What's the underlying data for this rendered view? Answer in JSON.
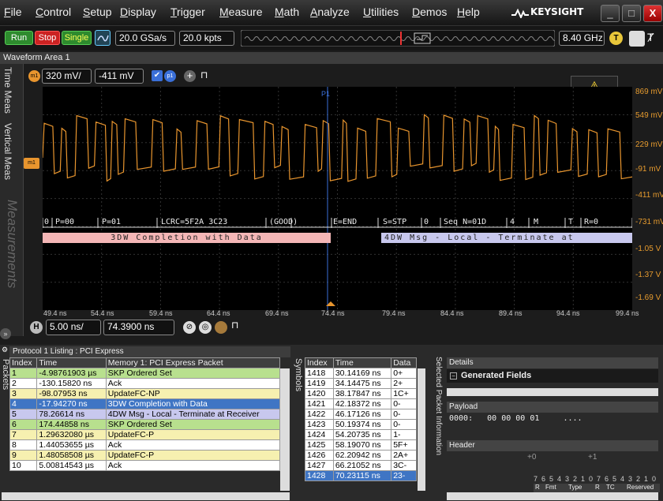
{
  "menubar": {
    "items": [
      "File",
      "Control",
      "Setup",
      "Display",
      "Trigger",
      "Measure",
      "Math",
      "Analyze",
      "Utilities",
      "Demos",
      "Help"
    ],
    "brand": "KEYSIGHT"
  },
  "toolbar": {
    "run": "Run",
    "stop": "Stop",
    "single": "Single",
    "sample_rate": "20.0 GSa/s",
    "points": "20.0 kpts",
    "bandwidth": "8.40 GHz",
    "trigger_badge": "T"
  },
  "waveform_area": {
    "title": "Waveform Area 1",
    "scale": "320 mV/",
    "offset": "-411 mV",
    "p1_label": "p1",
    "marker_label": "m1",
    "cursor_label": "P1",
    "side_tabs": [
      "Time Meas",
      "Vertical Meas",
      "Measurements"
    ],
    "y_labels": [
      "869 mV",
      "549 mV",
      "229 mV",
      "-91 mV",
      "-411 mV",
      "-731 mV",
      "-1.05 V",
      "-1.37 V",
      "-1.69 V"
    ],
    "x_labels": [
      "49.4 ns",
      "54.4 ns",
      "59.4 ns",
      "64.4 ns",
      "69.4 ns",
      "74.4 ns",
      "79.4 ns",
      "84.4 ns",
      "89.4 ns",
      "94.4 ns",
      "99.4 ns"
    ],
    "decode_top": [
      "0",
      "P=00",
      "P=01",
      "LCRC=5F2A 3C23",
      "(GOOD)",
      "E=END",
      "S=STP",
      "0",
      "Seq N=01D",
      "4",
      "M",
      "T",
      "R=0"
    ],
    "decode_bottom_left": "3DW Completion with Data",
    "decode_bottom_right": "4DW Msg - Local - Terminate at",
    "colors": {
      "trace": "#e8952e",
      "decode_pink": "#f4b6b6",
      "decode_lavender": "#c8c8ee"
    }
  },
  "horizontal": {
    "badge": "H",
    "scale": "5.00 ns/",
    "position": "74.3900 ns"
  },
  "listing": {
    "title": "Protocol 1 Listing : PCI Express",
    "side_tab": "Packets",
    "headers": [
      "Index",
      "Time",
      "Memory 1: PCI Express Packet"
    ],
    "rows": [
      {
        "index": "1",
        "time": "-4.98761903 µs",
        "packet": "SKP Ordered Set",
        "color": "#b8e08e"
      },
      {
        "index": "2",
        "time": "-130.15820 ns",
        "packet": "Ack",
        "color": "#ffffff"
      },
      {
        "index": "3",
        "time": "-98.07953 ns",
        "packet": "UpdateFC-NP",
        "color": "#f6f0b0"
      },
      {
        "index": "4",
        "time": "-17.94270 ns",
        "packet": "3DW Completion with Data",
        "color": "#3f75c4"
      },
      {
        "index": "5",
        "time": "78.26614 ns",
        "packet": "4DW Msg - Local - Terminate at Receiver",
        "color": "#c8c8ee"
      },
      {
        "index": "6",
        "time": "174.44858 ns",
        "packet": "SKP Ordered Set",
        "color": "#b8e08e"
      },
      {
        "index": "7",
        "time": "1.29632080 µs",
        "packet": "UpdateFC-P",
        "color": "#f6f0b0"
      },
      {
        "index": "8",
        "time": "1.44053655 µs",
        "packet": "Ack",
        "color": "#ffffff"
      },
      {
        "index": "9",
        "time": "1.48058508 µs",
        "packet": "UpdateFC-P",
        "color": "#f6f0b0"
      },
      {
        "index": "10",
        "time": "5.00814543 µs",
        "packet": "Ack",
        "color": "#ffffff"
      }
    ]
  },
  "symbols": {
    "side_tab": "Symbols",
    "headers": [
      "Index",
      "Time",
      "Data"
    ],
    "rows": [
      {
        "index": "1418",
        "time": "30.14169 ns",
        "data": "0+"
      },
      {
        "index": "1419",
        "time": "34.14475 ns",
        "data": "2+"
      },
      {
        "index": "1420",
        "time": "38.17847 ns",
        "data": "1C+"
      },
      {
        "index": "1421",
        "time": "42.18372 ns",
        "data": "0-"
      },
      {
        "index": "1422",
        "time": "46.17126 ns",
        "data": "0-"
      },
      {
        "index": "1423",
        "time": "50.19374 ns",
        "data": "0-"
      },
      {
        "index": "1424",
        "time": "54.20735 ns",
        "data": "1-"
      },
      {
        "index": "1425",
        "time": "58.19070 ns",
        "data": "5F+"
      },
      {
        "index": "1426",
        "time": "62.20942 ns",
        "data": "2A+"
      },
      {
        "index": "1427",
        "time": "66.21052 ns",
        "data": "3C-"
      },
      {
        "index": "1428",
        "time": "70.23115 ns",
        "data": "23-"
      }
    ]
  },
  "packet_info": {
    "side_tab": "Selected Packet Information",
    "details": "Details",
    "generated_fields": "Generated Fields",
    "payload": "Payload",
    "payload_line": "0000:   00 00 00 01     ....",
    "header": "Header",
    "plus0": "+0",
    "plus1": "+1",
    "bits": [
      "7",
      "6",
      "5",
      "4",
      "3",
      "2",
      "1",
      "0",
      "7",
      "6",
      "5",
      "4",
      "3",
      "2",
      "1",
      "0"
    ],
    "fields": [
      "R",
      "Fmt",
      "Type",
      "R",
      "TC",
      "Reserved"
    ]
  }
}
